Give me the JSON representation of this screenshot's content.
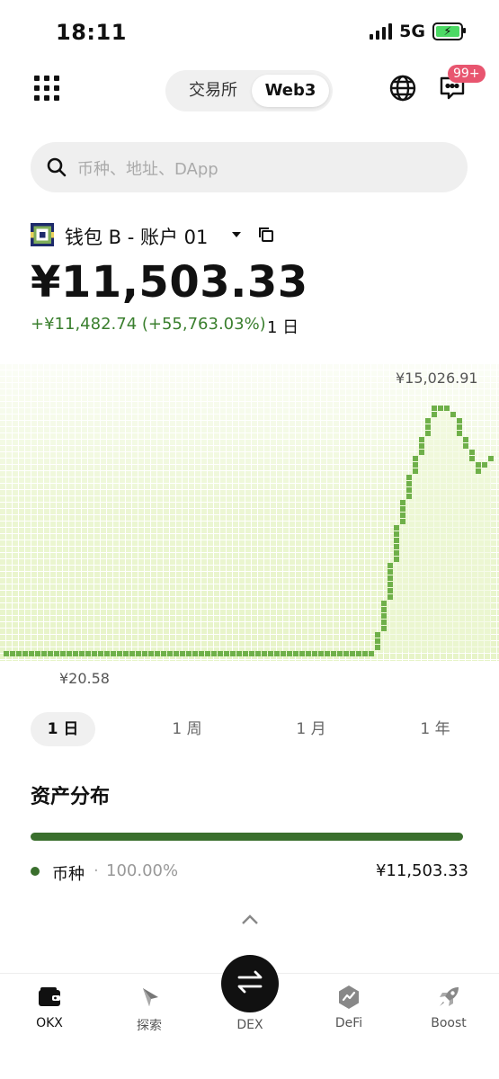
{
  "status": {
    "time": "18:11",
    "network": "5G"
  },
  "header": {
    "tabs": [
      {
        "label": "交易所",
        "active": false
      },
      {
        "label": "Web3",
        "active": true
      }
    ],
    "badge": "99+",
    "icons": [
      "grid-menu-icon",
      "globe-icon",
      "message-icon"
    ]
  },
  "search": {
    "placeholder": "币种、地址、DApp"
  },
  "account": {
    "name": "钱包 B - 账户 01",
    "balance": "¥11,503.33",
    "change": "+¥11,482.74 (+55,763.03%)",
    "change_period": "1 日"
  },
  "chart": {
    "max_label": "¥15,026.91",
    "min_label": "¥20.58",
    "ranges": [
      {
        "label": "1 日",
        "active": true
      },
      {
        "label": "1 周",
        "active": false
      },
      {
        "label": "1 月",
        "active": false
      },
      {
        "label": "1 年",
        "active": false
      }
    ]
  },
  "chart_data": {
    "type": "area",
    "title": "",
    "xlabel": "",
    "ylabel": "",
    "series": [
      {
        "values": [
          20.58,
          20.58,
          20.58,
          20.58,
          20.58,
          20.58,
          20.58,
          20.58,
          20.58,
          20.58,
          20.58,
          20.58,
          20.58,
          20.58,
          20.58,
          20.58,
          20.58,
          20.58,
          20.58,
          20.58,
          20.58,
          20.58,
          20.58,
          20.58,
          20.58,
          20.58,
          20.58,
          20.58,
          20.58,
          20.58,
          20.58,
          20.58,
          20.58,
          20.58,
          20.58,
          20.58,
          20.58,
          20.58,
          20.58,
          20.58,
          20.58,
          20.58,
          20.58,
          20.58,
          20.58,
          20.58,
          20.58,
          20.58,
          20.58,
          20.58,
          20.58,
          20.58,
          20.58,
          20.58,
          20.58,
          20.58,
          20.58,
          20.58,
          20.58,
          1200,
          3100,
          5200,
          7500,
          9400,
          10900,
          12100,
          13200,
          14200,
          14900,
          15026.91,
          15026.91,
          14700,
          13700,
          12700,
          11800,
          11300,
          11600,
          12100
        ]
      }
    ],
    "ylim": [
      20.58,
      15026.91
    ],
    "colors": {
      "line": "#6fb04a",
      "fill": "#eef7d5"
    }
  },
  "assets": {
    "title": "资产分布",
    "items": [
      {
        "name": "币种",
        "separator": "·",
        "percent": "100.00%",
        "value": "¥11,503.33"
      }
    ],
    "bar_color": "#3a6f2d"
  },
  "nav": {
    "items": [
      {
        "label": "OKX",
        "icon": "wallet-icon"
      },
      {
        "label": "探索",
        "icon": "compass-icon"
      },
      {
        "label": "DEX",
        "icon": "swap-icon"
      },
      {
        "label": "DeFi",
        "icon": "defi-icon"
      },
      {
        "label": "Boost",
        "icon": "rocket-icon"
      }
    ]
  }
}
